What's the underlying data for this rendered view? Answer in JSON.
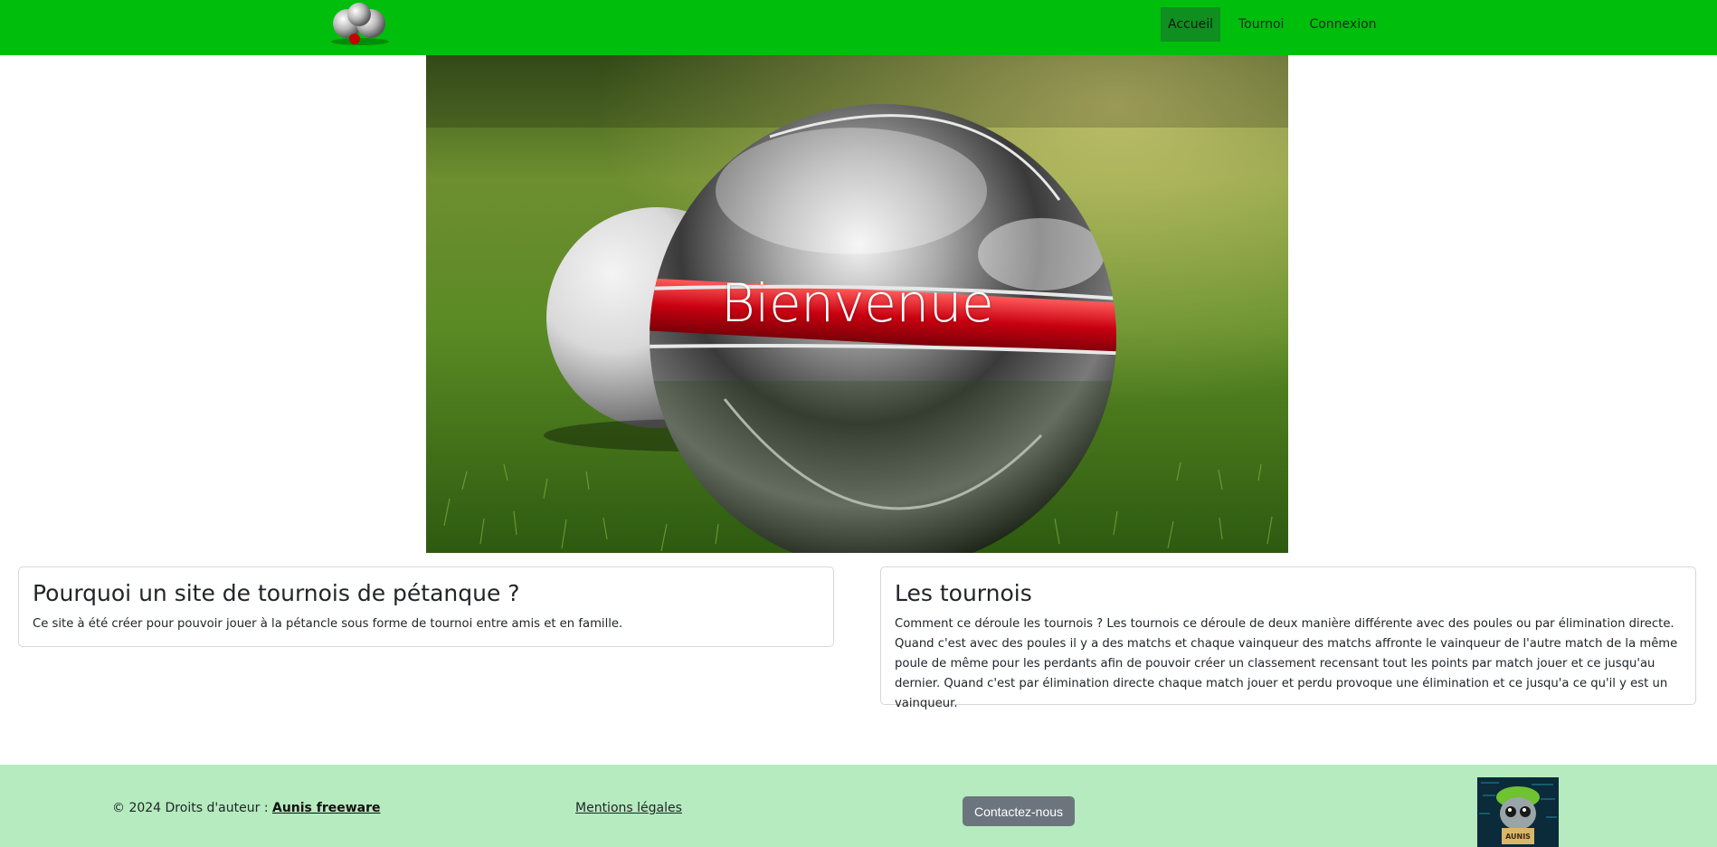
{
  "nav": {
    "items": [
      {
        "label": "Accueil",
        "active": true
      },
      {
        "label": "Tournoi",
        "active": false
      },
      {
        "label": "Connexion",
        "active": false
      }
    ],
    "bg_color": "#00be0c",
    "active_color": "#0e8f20"
  },
  "hero": {
    "title": "Bienvenue"
  },
  "cards": [
    {
      "title": "Pourquoi un site de tournois de pétanque ?",
      "text": "Ce site à été créer pour pouvoir jouer à la pétancle sous forme de tournoi entre amis et en famille."
    },
    {
      "title": "Les tournois",
      "text": "Comment ce déroule les tournois ? Les tournois ce déroule de deux manière différente avec des poules ou par élimination directe. Quand c'est avec des poules il y a des matchs et chaque vainqueur des matchs affronte le vainqueur de l'autre match de la même poule de même pour les perdants afin de pouvoir créer un classement recensant tout les points par match jouer et ce jusqu'au dernier. Quand c'est par élimination directe chaque match jouer et perdu provoque une élimination et ce jusqu'a ce qu'il y est un vainqueur."
    }
  ],
  "footer": {
    "copyright_prefix": "© 2024 Droits d'auteur : ",
    "brand": "Aunis freeware",
    "legal_label": "Mentions légales",
    "contact_label": "Contactez-nous",
    "logo_text": "AUNIS",
    "bg_color": "#b5ebbe"
  }
}
